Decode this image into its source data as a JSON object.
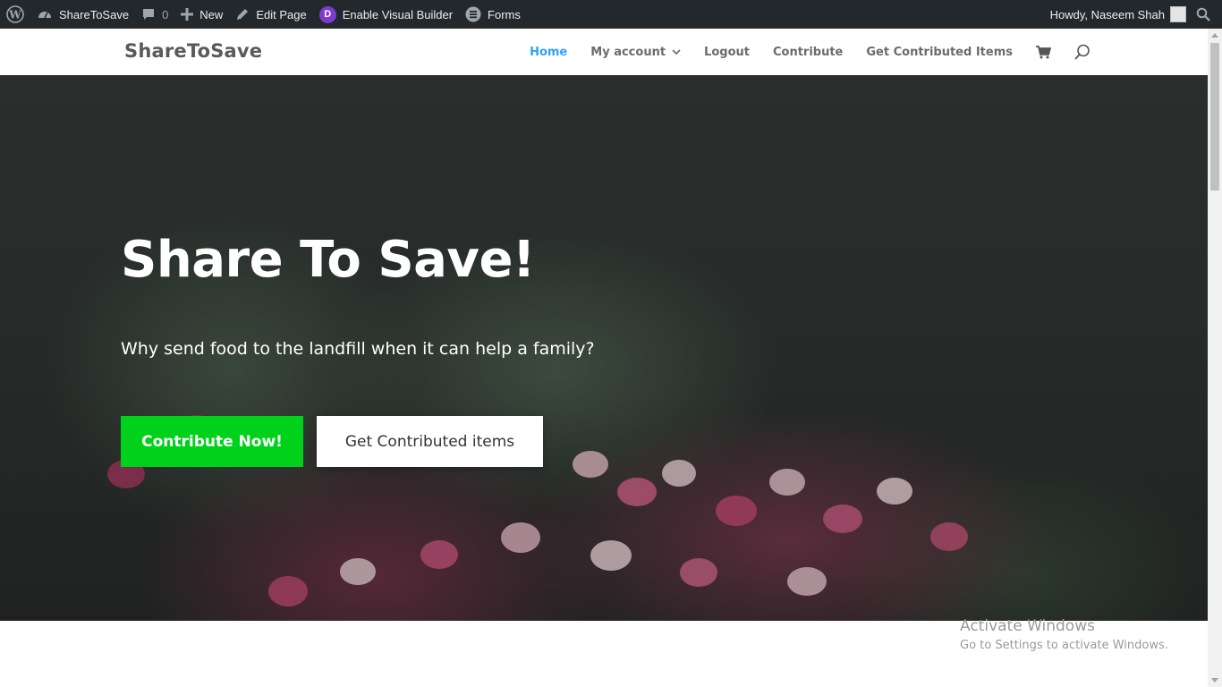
{
  "admin_bar": {
    "site_name": "ShareToSave",
    "comments_count": "0",
    "new_label": "New",
    "edit_page_label": "Edit Page",
    "visual_builder_label": "Enable Visual Builder",
    "forms_label": "Forms",
    "greeting": "Howdy, Naseem Shah",
    "icons": [
      "wordpress-icon",
      "dashboard-icon",
      "comment-icon",
      "plus-icon",
      "pencil-icon",
      "divi-icon",
      "forms-icon",
      "search-icon"
    ]
  },
  "header": {
    "logo": "ShareToSave",
    "nav": {
      "home": "Home",
      "my_account": "My account",
      "logout": "Logout",
      "contribute": "Contribute",
      "get_contributed": "Get Contributed Items"
    },
    "accent_color": "#2ea3f2"
  },
  "hero": {
    "title": "Share To Save!",
    "subtitle": "Why send food to the landfill when it can help a family?",
    "primary_button": "Contribute Now!",
    "secondary_button": "Get Contributed items",
    "primary_color": "#00d11b"
  },
  "watermark": {
    "line1": "Activate Windows",
    "line2": "Go to Settings to activate Windows."
  }
}
